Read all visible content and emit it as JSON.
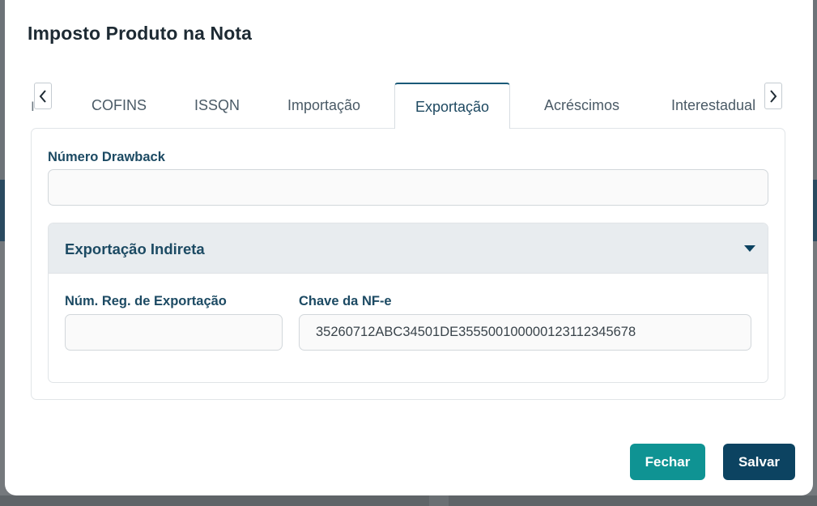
{
  "modal": {
    "title": "Imposto Produto na Nota"
  },
  "tabs": {
    "cut_label": "IS",
    "items": [
      {
        "label": "COFINS"
      },
      {
        "label": "ISSQN"
      },
      {
        "label": "Importação"
      },
      {
        "label": "Exportação"
      },
      {
        "label": "Acréscimos"
      },
      {
        "label": "Interestadual"
      }
    ],
    "active": "Exportação",
    "prev_icon": "chevron-left-icon",
    "next_icon": "chevron-right-icon"
  },
  "form": {
    "drawback": {
      "label": "Número Drawback",
      "value": ""
    },
    "indirect_export": {
      "title": "Exportação Indireta",
      "caret_icon": "caret-down-icon",
      "reg_number": {
        "label": "Núm. Reg. de Exportação",
        "value": ""
      },
      "nfe_key": {
        "label": "Chave da NF-e",
        "value": "35260712ABC34501DE355500100000123112345678"
      }
    }
  },
  "footer": {
    "close_label": "Fechar",
    "save_label": "Salvar"
  },
  "colors": {
    "primary": "#0c4361",
    "secondary": "#0f9393",
    "label": "#1c4a63"
  }
}
